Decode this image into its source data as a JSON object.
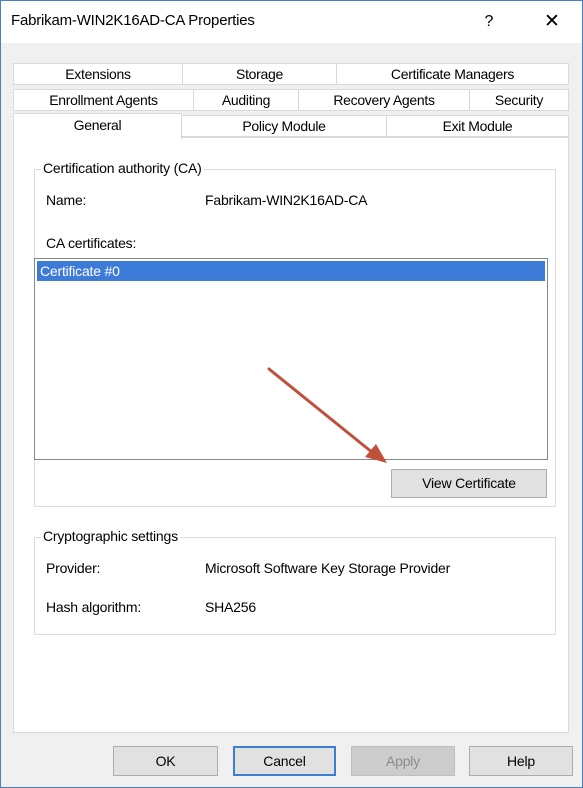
{
  "window": {
    "title": "Fabrikam-WIN2K16AD-CA Properties",
    "help_label": "?",
    "close_label": "✕"
  },
  "tabs": {
    "row1": [
      "Extensions",
      "Storage",
      "Certificate Managers"
    ],
    "row2": [
      "Enrollment Agents",
      "Auditing",
      "Recovery Agents",
      "Security"
    ],
    "row3": [
      "General",
      "Policy Module",
      "Exit Module"
    ],
    "active": "General"
  },
  "ca_group": {
    "label": "Certification authority (CA)",
    "name_label": "Name:",
    "name_value": "Fabrikam-WIN2K16AD-CA",
    "certs_label": "CA certificates:",
    "certificates": [
      "Certificate #0"
    ],
    "view_button": "View Certificate"
  },
  "crypto_group": {
    "label": "Cryptographic settings",
    "provider_label": "Provider:",
    "provider_value": "Microsoft Software Key Storage Provider",
    "hash_label": "Hash algorithm:",
    "hash_value": "SHA256"
  },
  "footer": {
    "ok": "OK",
    "cancel": "Cancel",
    "apply": "Apply",
    "help": "Help"
  },
  "colors": {
    "selection": "#3d7bd9",
    "annotation_arrow": "#c0503c",
    "window_border": "#4a7fc1"
  }
}
